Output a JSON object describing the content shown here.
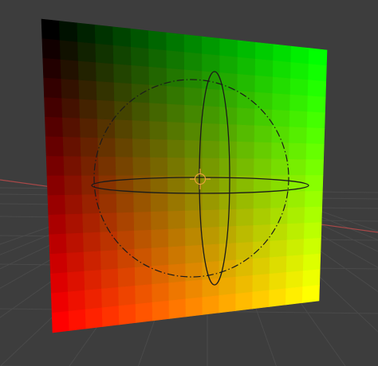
{
  "viewport": {
    "background": "#3d3d3d",
    "grid_line_color": "#4a4a4a",
    "x_axis_color": "#a84848"
  },
  "texture": {
    "rows": 16,
    "cols": 16,
    "corner_colors": {
      "top_left": "#000000",
      "top_right": "#00ff00",
      "bottom_left": "#ff0000",
      "bottom_right": "#ffff00"
    }
  },
  "rotation_gizmo": {
    "stroke_color": "#1b1b1b",
    "pivot_color": "#e8a23c",
    "icons": [
      "trackball-circle-icon",
      "x-rotation-ring-icon",
      "y-rotation-ring-icon",
      "pivot-point-icon"
    ]
  }
}
